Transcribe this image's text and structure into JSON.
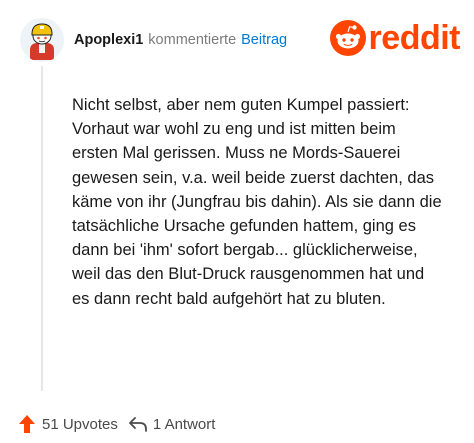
{
  "comment": {
    "username": "Apoplexi1",
    "action_text": "kommentierte",
    "post_link_text": "Beitrag",
    "body": "Nicht selbst, aber nem guten Kumpel passiert: Vorhaut war wohl zu eng und ist mitten beim ersten Mal gerissen. Muss ne Mords-Sauerei gewesen sein, v.a. weil beide zuerst dachten, das käme von ihr (Jungfrau bis dahin). Als sie dann die tatsächliche Ursache gefunden hattem, ging es dann bei 'ihm' sofort bergab... glücklicherweise, weil das den Blut-Druck rausgenommen hat und es dann recht bald aufgehört hat zu bluten."
  },
  "brand": {
    "name": "reddit",
    "color": "#ff4500"
  },
  "footer": {
    "upvotes_label": "51 Upvotes",
    "replies_label": "1 Antwort"
  },
  "icons": {
    "avatar": "snoo-avatar-icon",
    "brand": "reddit-snoo-icon",
    "upvote": "upvote-arrow-icon",
    "reply": "reply-arrow-icon"
  },
  "colors": {
    "username": "#1a1a1b",
    "muted": "#7c7c7c",
    "link": "#0079d3",
    "upvote": "#ff4500"
  }
}
